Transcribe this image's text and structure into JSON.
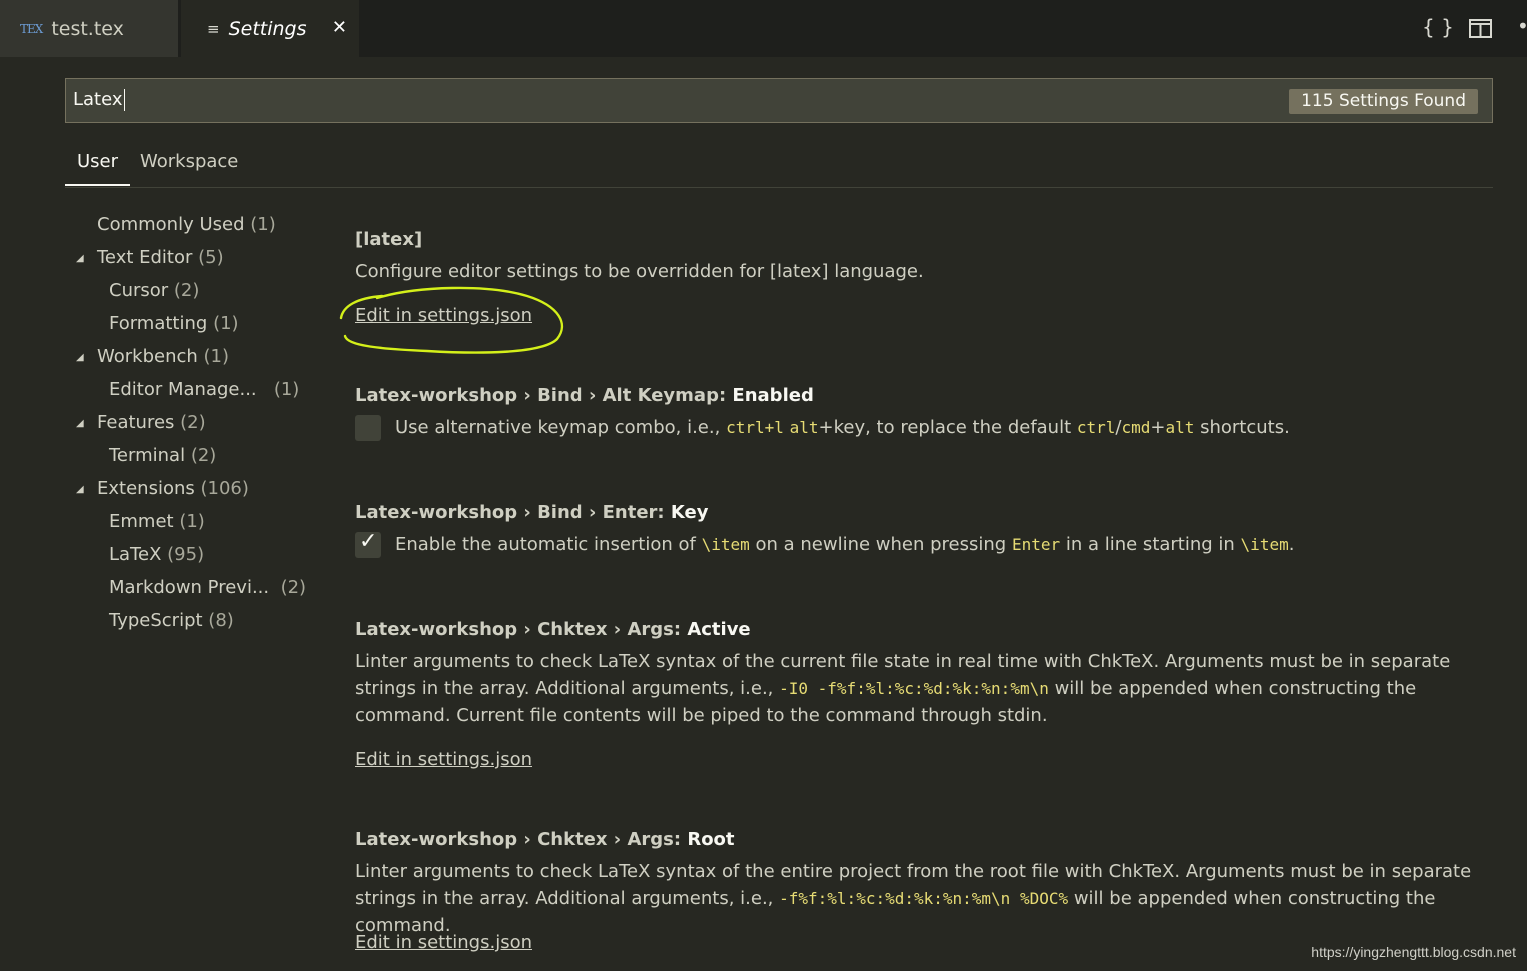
{
  "tabs": {
    "file_tab_icon": "TEX",
    "file_tab_label": "test.tex",
    "settings_tab_label": "Settings"
  },
  "icons": {
    "file_tab_icon": "tex-file-icon",
    "settings_tab_icon": "settings-list-icon",
    "close": "close-icon",
    "open_json": "braces-icon",
    "split_editor": "split-editor-icon",
    "more": "more-icon"
  },
  "search": {
    "value": "Latex",
    "result_count": "115 Settings Found"
  },
  "scope_tabs": [
    "User",
    "Workspace"
  ],
  "toc": [
    {
      "label": "Commonly Used",
      "count": "(1)"
    },
    {
      "label": "Text Editor",
      "count": "(5)"
    },
    {
      "label": "Cursor",
      "count": "(2)"
    },
    {
      "label": "Formatting",
      "count": "(1)"
    },
    {
      "label": "Workbench",
      "count": "(1)"
    },
    {
      "label": "Editor Manage...",
      "count": "(1)"
    },
    {
      "label": "Features",
      "count": "(2)"
    },
    {
      "label": "Terminal",
      "count": "(2)"
    },
    {
      "label": "Extensions",
      "count": "(106)"
    },
    {
      "label": "Emmet",
      "count": "(1)"
    },
    {
      "label": "LaTeX",
      "count": "(95)"
    },
    {
      "label": "Markdown Previ...",
      "count": "(2)"
    },
    {
      "label": "TypeScript",
      "count": "(8)"
    }
  ],
  "settings": {
    "lang": {
      "title": "[latex]",
      "description": "Configure editor settings to be overridden for [latex] language.",
      "link": "Edit in settings.json"
    },
    "altkeymap": {
      "cat1": "Latex-workshop › Bind › Alt Keymap: ",
      "key": "Enabled",
      "checked": false,
      "d1": "Use alternative keymap combo, i.e., ",
      "c1": "ctrl+l",
      "d2": " ",
      "c2": "alt",
      "d3": "+key, to replace the default ",
      "c3": "ctrl",
      "d4": "/",
      "c4": "cmd",
      "d5": "+",
      "c5": "alt",
      "d6": " shortcuts."
    },
    "enterkey": {
      "cat1": "Latex-workshop › Bind › Enter: ",
      "key": "Key",
      "checked": true,
      "d1": "Enable the automatic insertion of ",
      "c1": "\\item",
      "d2": " on a newline when pressing ",
      "c2": "Enter",
      "d3": " in a line starting in ",
      "c3": "\\item",
      "d4": "."
    },
    "active": {
      "cat1": "Latex-workshop › Chktex › Args: ",
      "key": "Active",
      "d1": "Linter arguments to check LaTeX syntax of the current file state in real time with ChkTeX. Arguments must be in separate strings in the array. Additional arguments, i.e., ",
      "c1": "-I0 -f%f:%l:%c:%d:%k:%n:%m\\n",
      "d2": " will be appended when constructing the command. Current file contents will be piped to the command through stdin.",
      "link": "Edit in settings.json"
    },
    "root": {
      "cat1": "Latex-workshop › Chktex › Args: ",
      "key": "Root",
      "d1": "Linter arguments to check LaTeX syntax of the entire project from the root file with ChkTeX. Arguments must be in separate strings in the array. Additional arguments, i.e., ",
      "c1": "-f%f:%l:%c:%d:%k:%n:%m\\n %DOC%",
      "d2": " will be appended when constructing the command.",
      "link": "Edit in settings.json"
    }
  },
  "watermark": "https://yingzhengttt.blog.csdn.net",
  "colors": {
    "background": "#272822",
    "tab_bar": "#1e1f1c",
    "code_text": "#e6db74",
    "annotation_circle": "#d4f01a"
  }
}
